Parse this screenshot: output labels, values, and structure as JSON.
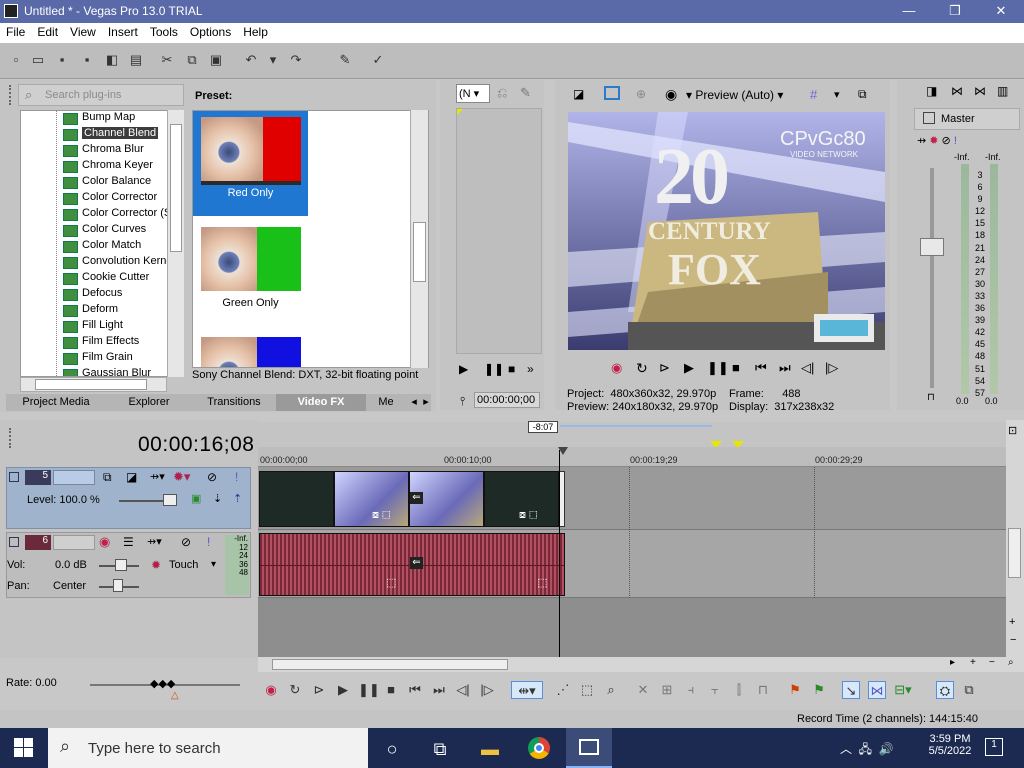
{
  "window": {
    "title": "Untitled * - Vegas Pro 13.0 TRIAL",
    "minimize": "—",
    "maximize": "❐",
    "close": "✕"
  },
  "menu": [
    "File",
    "Edit",
    "View",
    "Insert",
    "Tools",
    "Options",
    "Help"
  ],
  "plugins": {
    "search_placeholder": "Search plug-ins",
    "items": [
      "Bump Map",
      "Channel Blend",
      "Chroma Blur",
      "Chroma Keyer",
      "Color Balance",
      "Color Corrector",
      "Color Corrector (S",
      "Color Curves",
      "Color Match",
      "Convolution Kerne",
      "Cookie Cutter",
      "Defocus",
      "Deform",
      "Fill Light",
      "Film Effects",
      "Film Grain",
      "Gaussian Blur"
    ],
    "selected": "Channel Blend"
  },
  "presets": {
    "label": "Preset:",
    "items": [
      "Red Only",
      "Green Only"
    ],
    "selected": "Red Only",
    "description": "Sony Channel Blend: DXT, 32-bit floating point"
  },
  "tabs": [
    "Project Media",
    "Explorer",
    "Transitions",
    "Video FX",
    "Me"
  ],
  "active_tab": "Video FX",
  "trimmer": {
    "dropdown": "(N",
    "timecode": "00:00:00;00"
  },
  "preview": {
    "quality": "Preview (Auto)",
    "project_label": "Project:",
    "project_value": "480x360x32, 29.970p",
    "preview_label": "Preview:",
    "preview_value": "240x180x32, 29.970p",
    "frame_label": "Frame:",
    "frame_value": "488",
    "display_label": "Display:",
    "display_value": "317x238x32",
    "overlay_text": "CPvGc80",
    "overlay_sub": "VIDEO NETWORK",
    "big1": "20",
    "big2": "CENTURY",
    "big3": "FOX"
  },
  "mixer": {
    "label": "Master",
    "inf_left": "-Inf.",
    "inf_right": "-Inf.",
    "scale": [
      "3",
      "6",
      "9",
      "12",
      "15",
      "18",
      "21",
      "24",
      "27",
      "30",
      "33",
      "36",
      "39",
      "42",
      "45",
      "48",
      "51",
      "54",
      "57"
    ],
    "val_left": "0.0",
    "val_right": "0.0"
  },
  "timeline": {
    "timecode": "00:00:16;08",
    "region_badge": "-8:07",
    "ruler": [
      "00:00:00;00",
      "00:00:10;00",
      "00:00:19;29",
      "00:00:29;29"
    ]
  },
  "track1": {
    "number": "5",
    "level": "Level: 100.0 %"
  },
  "track2": {
    "number": "6",
    "vol_label": "Vol:",
    "vol_value": "0.0 dB",
    "pan_label": "Pan:",
    "pan_value": "Center",
    "automation": "Touch",
    "inf": "-Inf.",
    "meter": [
      "12",
      "24",
      "36",
      "48"
    ]
  },
  "rate": "Rate: 0.00",
  "status": "Record Time (2 channels): 144:15:40",
  "taskbar": {
    "search": "Type here to search",
    "time": "3:59 PM",
    "date": "5/5/2022",
    "notif": "1"
  },
  "colors": {
    "accent": "#1f77d2",
    "titlebar": "#5a6aa8",
    "audio": "#b05060"
  }
}
